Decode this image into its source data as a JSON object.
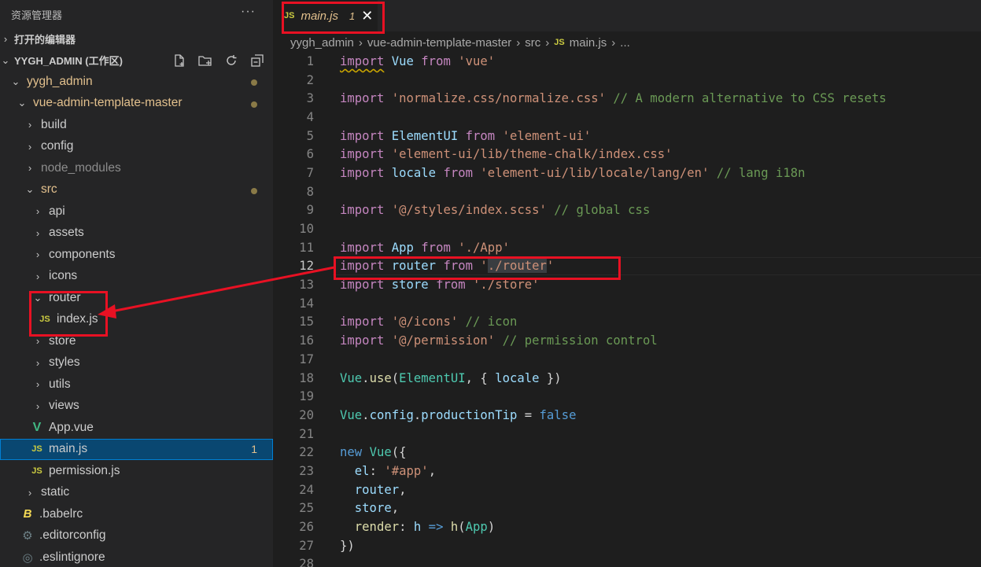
{
  "explorer": {
    "title": "资源管理器",
    "more_label": "···",
    "open_editors_label": "打开的编辑器",
    "workspace_label": "YYGH_ADMIN (工作区)",
    "tree": [
      {
        "label": "yygh_admin",
        "kind": "folder-open",
        "status": "modified"
      },
      {
        "label": "vue-admin-template-master",
        "kind": "folder-open",
        "status": "modified"
      },
      {
        "label": "build",
        "kind": "folder"
      },
      {
        "label": "config",
        "kind": "folder"
      },
      {
        "label": "node_modules",
        "kind": "folder",
        "status": "dim"
      },
      {
        "label": "src",
        "kind": "folder-open",
        "status": "modified"
      },
      {
        "label": "api",
        "kind": "folder"
      },
      {
        "label": "assets",
        "kind": "folder"
      },
      {
        "label": "components",
        "kind": "folder"
      },
      {
        "label": "icons",
        "kind": "folder"
      },
      {
        "label": "router",
        "kind": "folder-open"
      },
      {
        "label": "index.js",
        "kind": "js"
      },
      {
        "label": "store",
        "kind": "folder"
      },
      {
        "label": "styles",
        "kind": "folder"
      },
      {
        "label": "utils",
        "kind": "folder"
      },
      {
        "label": "views",
        "kind": "folder"
      },
      {
        "label": "App.vue",
        "kind": "vue"
      },
      {
        "label": "main.js",
        "kind": "js",
        "badge": "1",
        "selected": true
      },
      {
        "label": "permission.js",
        "kind": "js"
      },
      {
        "label": "static",
        "kind": "folder"
      },
      {
        "label": ".babelrc",
        "kind": "babel"
      },
      {
        "label": ".editorconfig",
        "kind": "gear"
      },
      {
        "label": ".eslintignore",
        "kind": "gear"
      }
    ]
  },
  "tab": {
    "icon": "JS",
    "name": "main.js",
    "problems": "1",
    "close": "✕"
  },
  "breadcrumb": {
    "parts": [
      "yygh_admin",
      "vue-admin-template-master",
      "src"
    ],
    "file_icon": "JS",
    "file": "main.js",
    "tail": "..."
  },
  "code_lines": [
    "1",
    "2",
    "3",
    "4",
    "5",
    "6",
    "7",
    "8",
    "9",
    "10",
    "11",
    "12",
    "13",
    "14",
    "15",
    "16",
    "17",
    "18",
    "19",
    "20",
    "21",
    "22",
    "23",
    "24",
    "25",
    "26",
    "27",
    "28"
  ],
  "code": {
    "l1": {
      "kw": "import",
      "id": "Vue",
      "from": "from",
      "str": "'vue'"
    },
    "l3": {
      "kw": "import",
      "str": "'normalize.css/normalize.css'",
      "cm": "// A modern alternative to CSS resets"
    },
    "l5": {
      "kw": "import",
      "id": "ElementUI",
      "from": "from",
      "str": "'element-ui'"
    },
    "l6": {
      "kw": "import",
      "str": "'element-ui/lib/theme-chalk/index.css'"
    },
    "l7": {
      "kw": "import",
      "id": "locale",
      "from": "from",
      "str": "'element-ui/lib/locale/lang/en'",
      "cm": "// lang i18n"
    },
    "l9": {
      "kw": "import",
      "str": "'@/styles/index.scss'",
      "cm": "// global css"
    },
    "l11": {
      "kw": "import",
      "id": "App",
      "from": "from",
      "str": "'./App'"
    },
    "l12": {
      "kw": "import",
      "id": "router",
      "from": "from",
      "q1": "'",
      "hl": "./router",
      "q2": "'"
    },
    "l13": {
      "kw": "import",
      "id": "store",
      "from": "from",
      "str": "'./store'"
    },
    "l15": {
      "kw": "import",
      "str": "'@/icons'",
      "cm": "// icon"
    },
    "l16": {
      "kw": "import",
      "str": "'@/permission'",
      "cm": "// permission control"
    },
    "l18": {
      "cls": "Vue",
      "dot": ".",
      "fn": "use",
      "p1": "(",
      "id1": "ElementUI",
      "p2": ", { ",
      "id2": "locale",
      "p3": " })"
    },
    "l20": {
      "cls": "Vue",
      "dot1": ".",
      "id1": "config",
      "dot2": ".",
      "id2": "productionTip",
      "eq": " = ",
      "bool": "false"
    },
    "l22": {
      "kw": "new",
      "cls": "Vue",
      "p": "({"
    },
    "l23": {
      "id": "el",
      "p": ": ",
      "str": "'#app'",
      "c": ","
    },
    "l24": {
      "id": "router",
      "c": ","
    },
    "l25": {
      "id": "store",
      "c": ","
    },
    "l26": {
      "id": "render",
      "p": ": ",
      "id2": "h",
      "arrow": " => ",
      "fn": "h",
      "p2": "(",
      "id3": "App",
      "p3": ")"
    },
    "l27": {
      "p": "})"
    }
  },
  "colors": {
    "annotation_red": "#e81123",
    "selection_blue": "#094771"
  }
}
